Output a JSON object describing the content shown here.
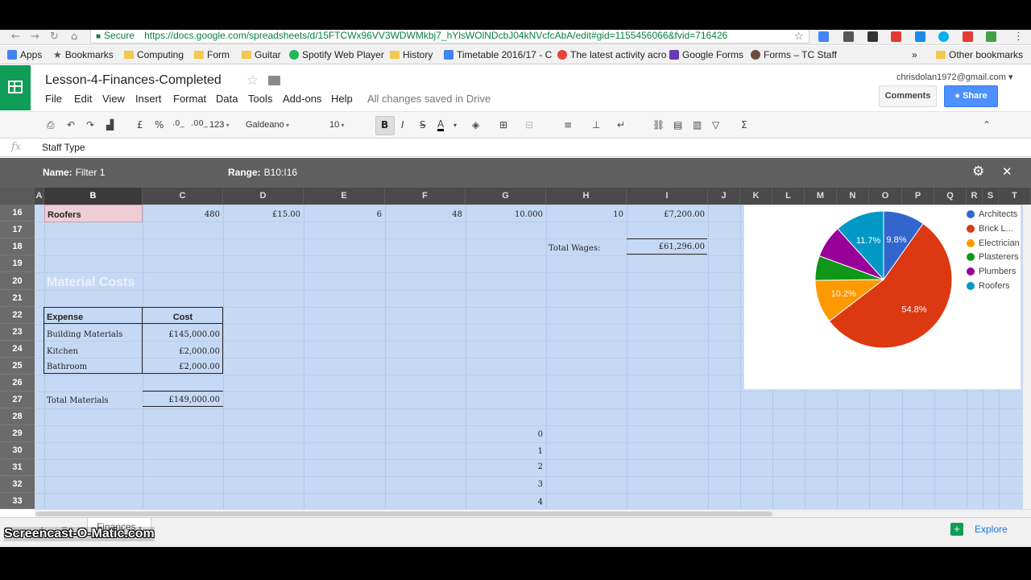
{
  "browser": {
    "secure_label": "Secure",
    "url": "https://docs.google.com/spreadsheets/d/15FTCWx96VV3WDWMkbj7_hYlsWOlNDcbJ04kNVcfcAbA/edit#gid=1155456066&fvid=716426"
  },
  "bookmarks": {
    "items": [
      "Apps",
      "Bookmarks",
      "Computing",
      "Form",
      "Guitar",
      "Spotify Web Player",
      "History",
      "Timetable 2016/17 - C",
      "The latest activity acro",
      "Google Forms",
      "Forms – TC Staff"
    ],
    "overflow": "»",
    "other": "Other bookmarks"
  },
  "sheet": {
    "title": "Lesson-4-Finances-Completed",
    "menu": [
      "File",
      "Edit",
      "View",
      "Insert",
      "Format",
      "Data",
      "Tools",
      "Add-ons",
      "Help"
    ],
    "saved_status": "All changes saved in Drive",
    "account": "chrisdolan1972@gmail.com",
    "comments_label": "Comments",
    "share_label": "Share"
  },
  "toolbar": {
    "currency": "£",
    "percent": "%",
    "decimal_less": ".0_",
    "decimal_more": ".00_",
    "number_format": "123",
    "font": "Galdeano",
    "font_size": "10",
    "bold": "B",
    "italic": "I",
    "strike": "S",
    "text_color": "A",
    "sum": "Σ"
  },
  "formula_bar": {
    "fx": "fx",
    "value": "Staff Type"
  },
  "filter": {
    "name_label": "Name:",
    "name": "Filter 1",
    "range_label": "Range:",
    "range": "B10:I16"
  },
  "columns": [
    "A",
    "B",
    "C",
    "D",
    "E",
    "F",
    "G",
    "H",
    "I",
    "J",
    "K",
    "L",
    "M",
    "N",
    "O",
    "P",
    "Q",
    "R",
    "S",
    "T"
  ],
  "rows": [
    "16",
    "17",
    "18",
    "19",
    "20",
    "21",
    "22",
    "23",
    "24",
    "25",
    "26",
    "27",
    "28",
    "29",
    "30",
    "31",
    "32",
    "33"
  ],
  "cells": {
    "roofers": "Roofers",
    "roofers_c": "480",
    "roofers_d": "£15.00",
    "roofers_e": "6",
    "roofers_f": "48",
    "roofers_g": "10.000",
    "roofers_h": "10",
    "roofers_i": "£7,200.00",
    "total_wages_label": "Total Wages:",
    "total_wages": "£61,296.00",
    "material_costs": "Material Costs",
    "expense_header": "Expense",
    "cost_header": "Cost",
    "materials": [
      {
        "name": "Building Materials",
        "cost": "£145,000.00"
      },
      {
        "name": "Kitchen",
        "cost": "£2,000.00"
      },
      {
        "name": "Bathroom",
        "cost": "£2,000.00"
      }
    ],
    "total_materials_label": "Total Materials",
    "total_materials": "£149,000.00",
    "index_values": [
      "0",
      "1",
      "2",
      "3",
      "4"
    ]
  },
  "chart_data": {
    "type": "pie",
    "categories": [
      "Architects",
      "Brick Layers",
      "Electrician",
      "Plasterers",
      "Plumbers",
      "Roofers"
    ],
    "legend_labels": [
      "Architects",
      "Brick L...",
      "Electrician",
      "Plasterers",
      "Plumbers",
      "Roofers"
    ],
    "values": [
      9.8,
      54.8,
      10.2,
      5.8,
      7.7,
      11.7
    ],
    "data_labels": [
      "9.8%",
      "54.8%",
      "10.2%",
      "",
      "",
      "11.7%"
    ],
    "colors": [
      "#3366cc",
      "#dc3912",
      "#ff9900",
      "#109618",
      "#990099",
      "#0099c6"
    ],
    "legend": "right"
  },
  "sheet_tabs": {
    "active": "Finances",
    "add": "+",
    "list": "≡"
  },
  "explore_label": "Explore",
  "watermark": "Screencast-O-Matic.com"
}
